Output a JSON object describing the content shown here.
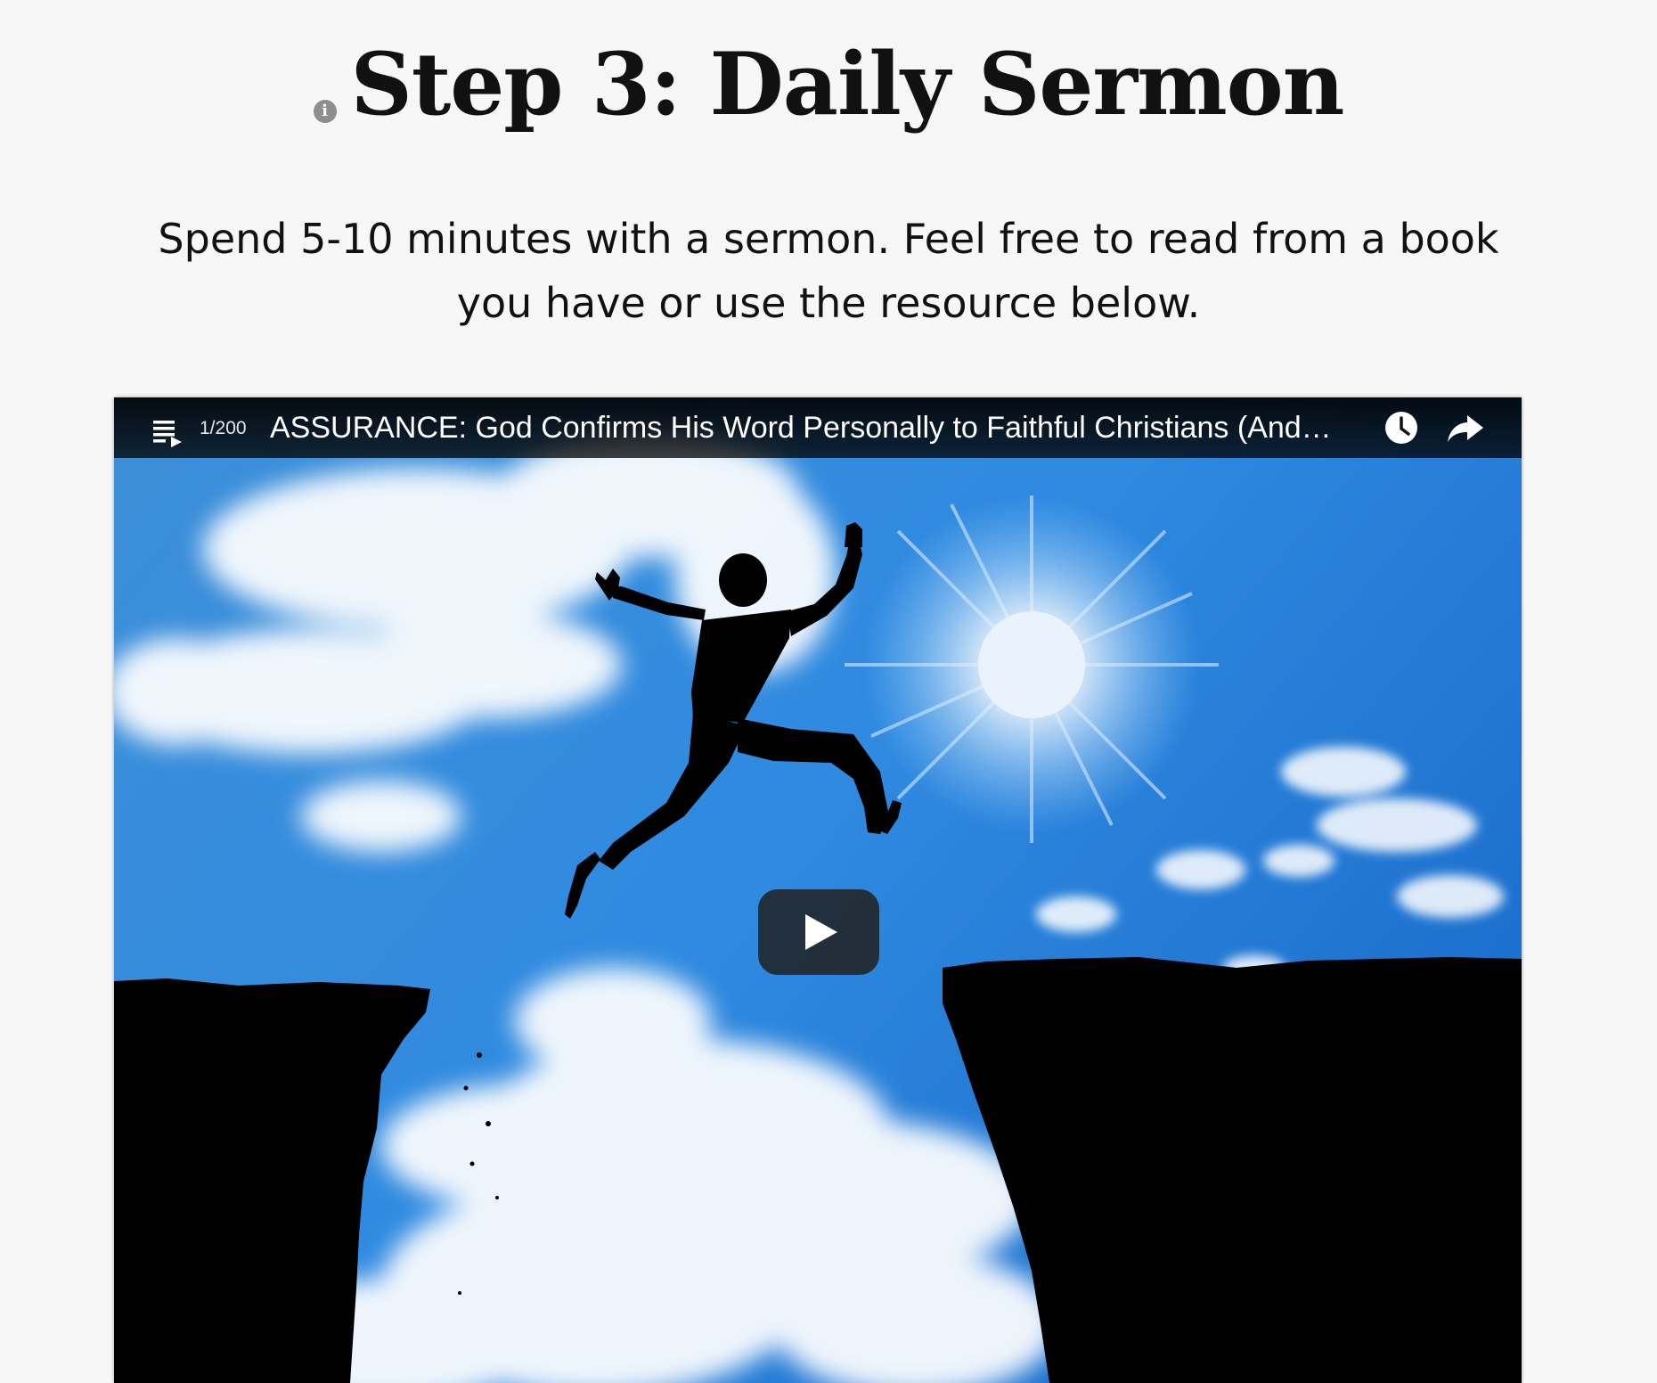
{
  "page": {
    "heading": "Step 3: Daily Sermon",
    "info_icon": "info-icon",
    "intro": "Spend 5-10 minutes with a sermon. Feel free to read from a book you have or use the resource below."
  },
  "video": {
    "playlist_position": "1/200",
    "title": "ASSURANCE: God Confirms His Word Personally to Faithful Christians (Andr...",
    "icons": {
      "playlist": "playlist-icon",
      "watch_later": "clock-icon",
      "share": "share-icon",
      "play": "play-icon"
    },
    "thumbnail_description_icon": "jumping-silhouette-image"
  },
  "colors": {
    "page_background": "#f7f7f7",
    "text": "#111111",
    "player_bar": "#000000",
    "sky": "#2a86d6"
  }
}
